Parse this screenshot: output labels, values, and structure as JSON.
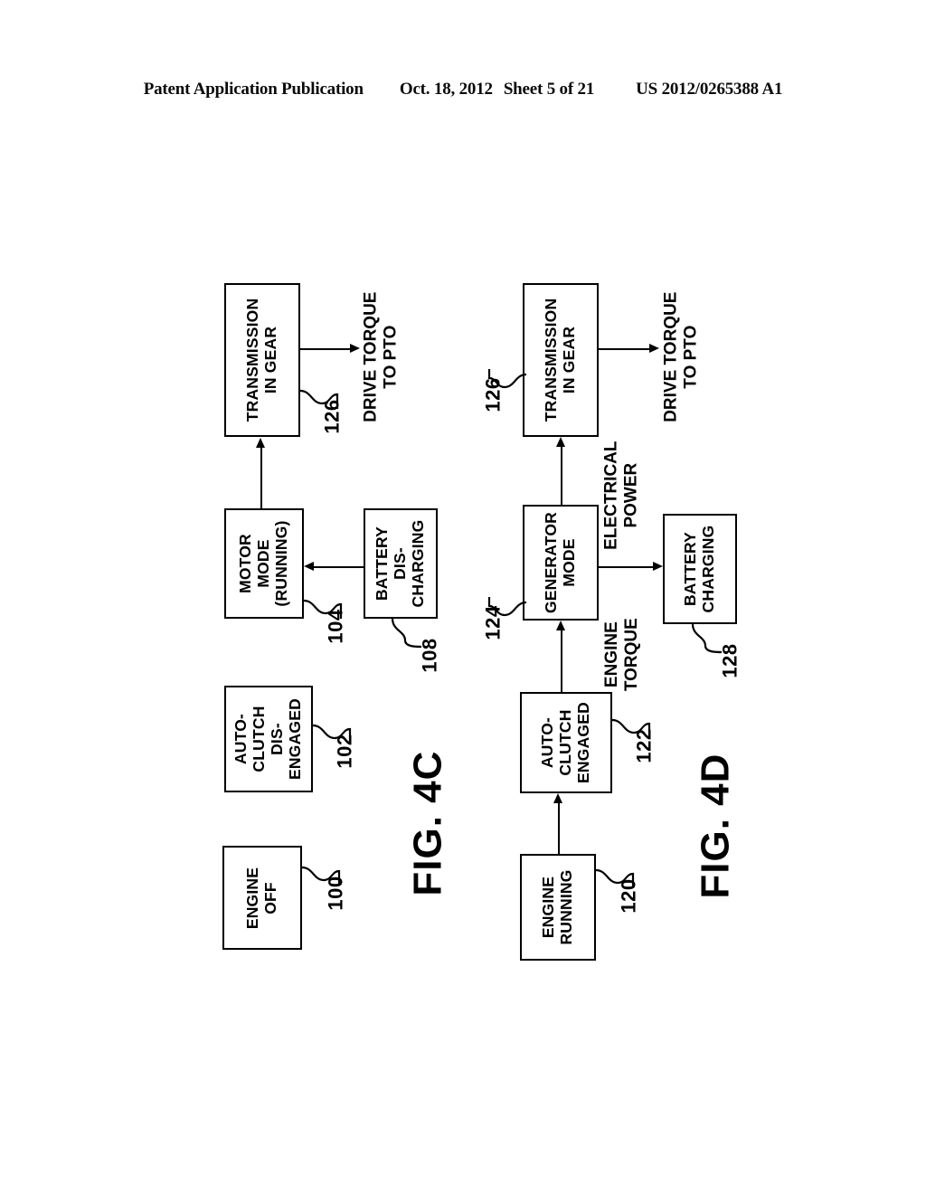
{
  "header": {
    "publication": "Patent Application Publication",
    "date": "Oct. 18, 2012",
    "sheet": "Sheet 5 of 21",
    "pub_number": "US 2012/0265388 A1"
  },
  "figures": [
    {
      "id": "fig-4c",
      "label": "FIG. 4C",
      "nodes": [
        {
          "key": "engine_off",
          "text": "ENGINE\nOFF",
          "ref": "100"
        },
        {
          "key": "auto_clutch_dis",
          "text": "AUTO-\nCLUTCH\nDIS-\nENGAGED",
          "ref": "102"
        },
        {
          "key": "motor_mode",
          "text": "MOTOR\nMODE\n(RUNNING)",
          "ref": "104"
        },
        {
          "key": "battery_discharge",
          "text": "BATTERY\nDIS-\nCHARGING",
          "ref": "108"
        },
        {
          "key": "transmission",
          "text": "TRANSMISSION\nIN GEAR",
          "ref": "126"
        }
      ],
      "annotations": [
        {
          "key": "drive_torque_pto",
          "text": "DRIVE TORQUE\nTO PTO"
        }
      ]
    },
    {
      "id": "fig-4d",
      "label": "FIG. 4D",
      "nodes": [
        {
          "key": "engine_running",
          "text": "ENGINE\nRUNNING",
          "ref": "120"
        },
        {
          "key": "auto_clutch_eng",
          "text": "AUTO-\nCLUTCH\nENGAGED",
          "ref": "122"
        },
        {
          "key": "generator_mode",
          "text": "GENERATOR\nMODE",
          "ref": "124"
        },
        {
          "key": "transmission",
          "text": "TRANSMISSION\nIN GEAR",
          "ref": "126"
        },
        {
          "key": "battery_charging",
          "text": "BATTERY\nCHARGING",
          "ref": "128"
        }
      ],
      "annotations": [
        {
          "key": "engine_torque",
          "text": "ENGINE\nTORQUE"
        },
        {
          "key": "electrical_power",
          "text": "ELECTRICAL\nPOWER"
        },
        {
          "key": "drive_torque_pto",
          "text": "DRIVE TORQUE\nTO PTO"
        }
      ]
    }
  ],
  "colors": {
    "ink": "#000000",
    "paper": "#ffffff"
  }
}
